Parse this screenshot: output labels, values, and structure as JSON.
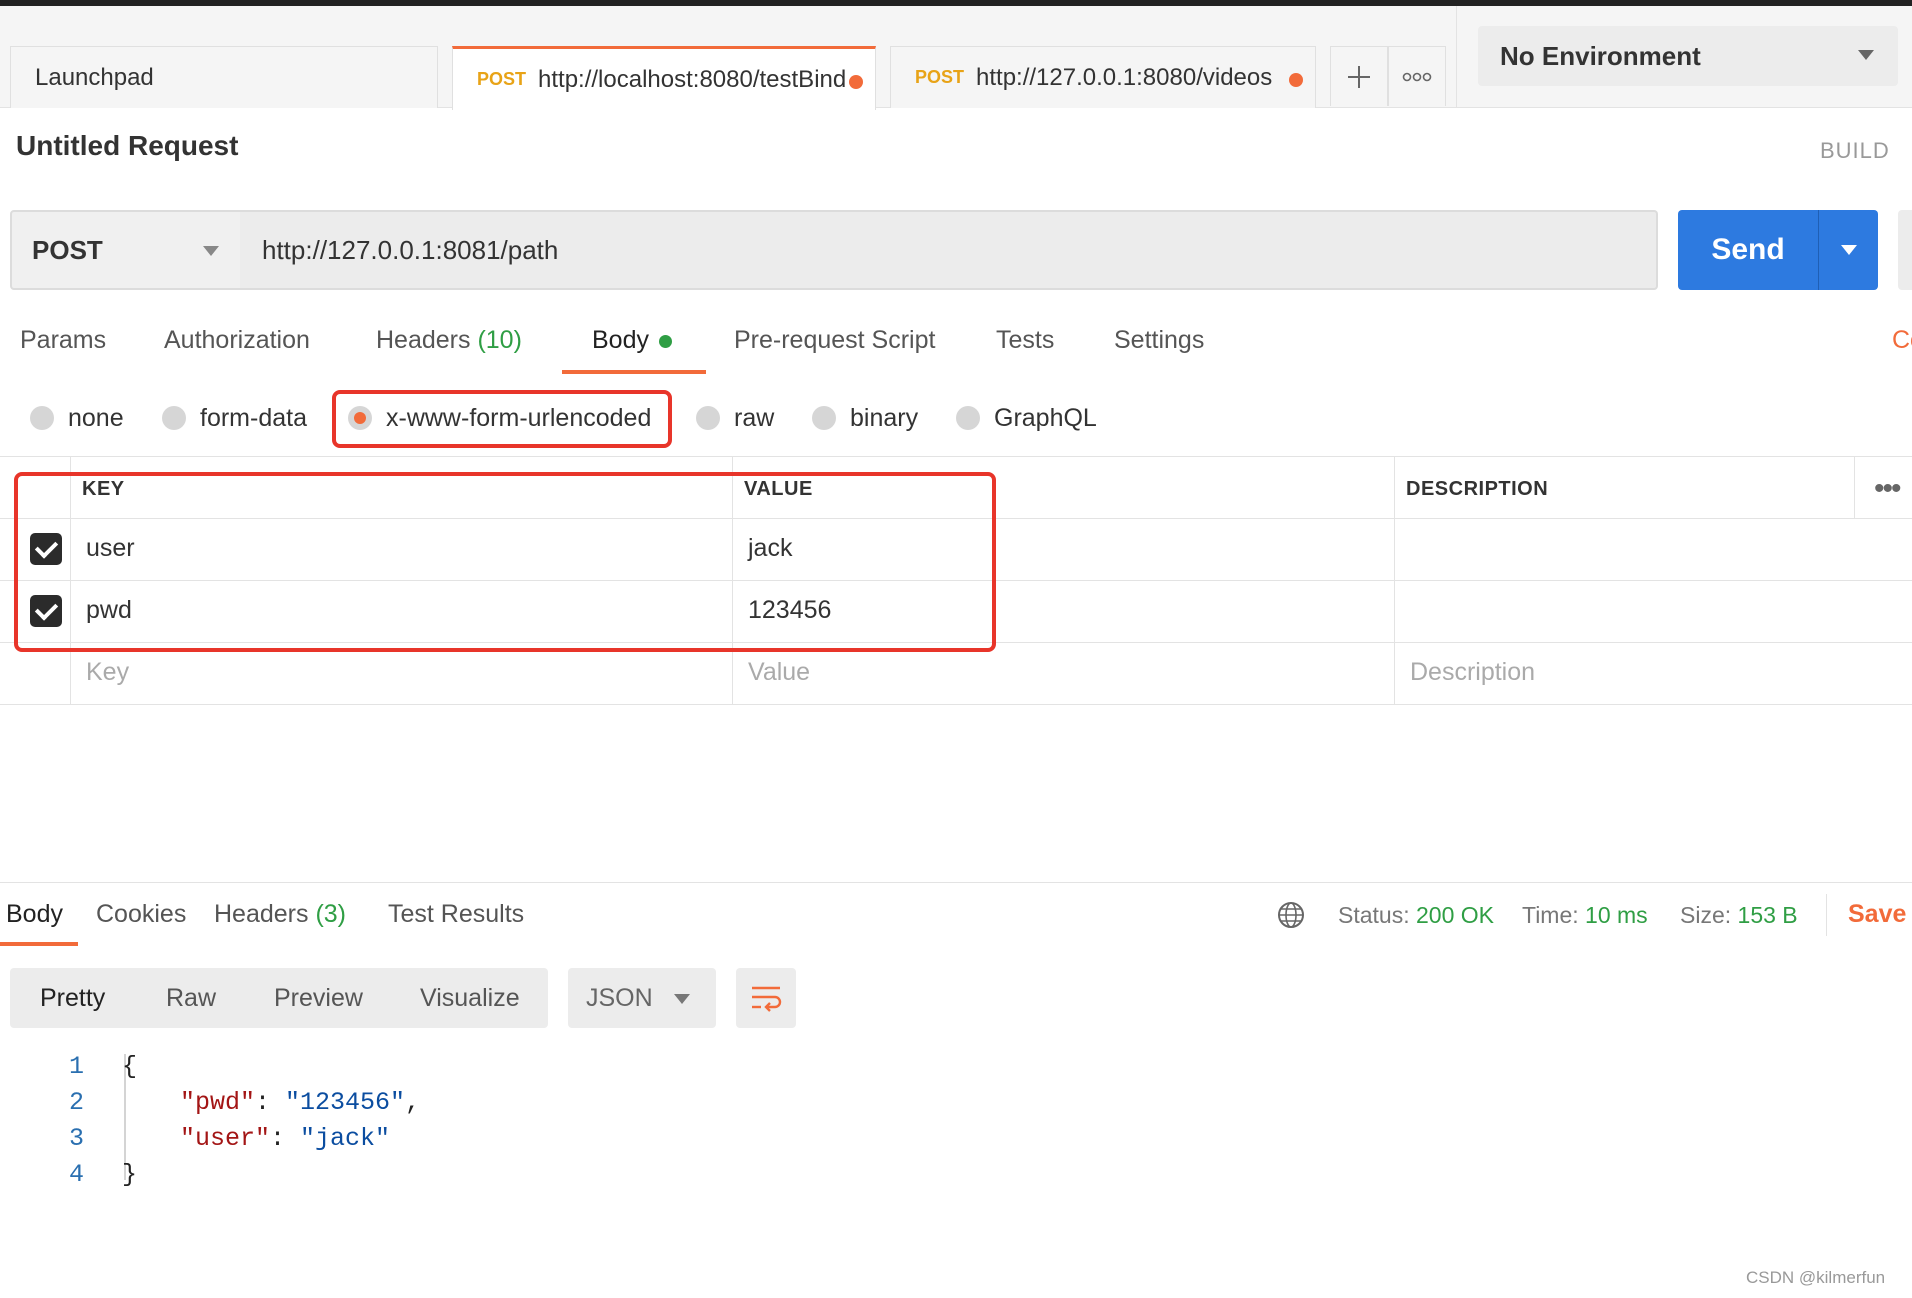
{
  "tabs": [
    {
      "label": "Launchpad",
      "method": ""
    },
    {
      "label": "http://localhost:8080/testBind",
      "method": "POST"
    },
    {
      "label": "http://127.0.0.1:8080/videos",
      "method": "POST"
    }
  ],
  "environment": {
    "selected": "No Environment"
  },
  "request": {
    "title": "Untitled Request",
    "build_label": "BUILD",
    "method": "POST",
    "url": "http://127.0.0.1:8081/path",
    "send_label": "Send"
  },
  "request_tabs": {
    "params": "Params",
    "authorization": "Authorization",
    "headers": "Headers",
    "headers_count": "(10)",
    "body": "Body",
    "pre_request": "Pre-request Script",
    "tests": "Tests",
    "settings": "Settings",
    "cookies_cut": "Co"
  },
  "body_types": [
    "none",
    "form-data",
    "x-www-form-urlencoded",
    "raw",
    "binary",
    "GraphQL"
  ],
  "body_type_selected": "x-www-form-urlencoded",
  "table": {
    "headers": {
      "key": "KEY",
      "value": "VALUE",
      "description": "DESCRIPTION"
    },
    "rows": [
      {
        "key": "user",
        "value": "jack",
        "description": "",
        "checked": true
      },
      {
        "key": "pwd",
        "value": "123456",
        "description": "",
        "checked": true
      }
    ],
    "placeholders": {
      "key": "Key",
      "value": "Value",
      "description": "Description"
    }
  },
  "response": {
    "tabs": {
      "body": "Body",
      "cookies": "Cookies",
      "headers": "Headers",
      "headers_count": "(3)",
      "test_results": "Test Results"
    },
    "status_label": "Status:",
    "status": "200 OK",
    "time_label": "Time:",
    "time": "10 ms",
    "size_label": "Size:",
    "size": "153 B",
    "save_label": "Save R",
    "views": [
      "Pretty",
      "Raw",
      "Preview",
      "Visualize"
    ],
    "format": "JSON",
    "code": {
      "line_numbers": [
        "1",
        "2",
        "3",
        "4"
      ],
      "open": "{",
      "close": "}",
      "pwd_key": "\"pwd\"",
      "pwd_value": "\"123456\"",
      "user_key": "\"user\"",
      "user_value": "\"jack\""
    }
  },
  "colors": {
    "accent": "#f26b3a",
    "send": "#2d7ae0",
    "success": "#2f9e44",
    "highlight_box": "#e8352a"
  },
  "watermark": "CSDN @kilmerfun"
}
